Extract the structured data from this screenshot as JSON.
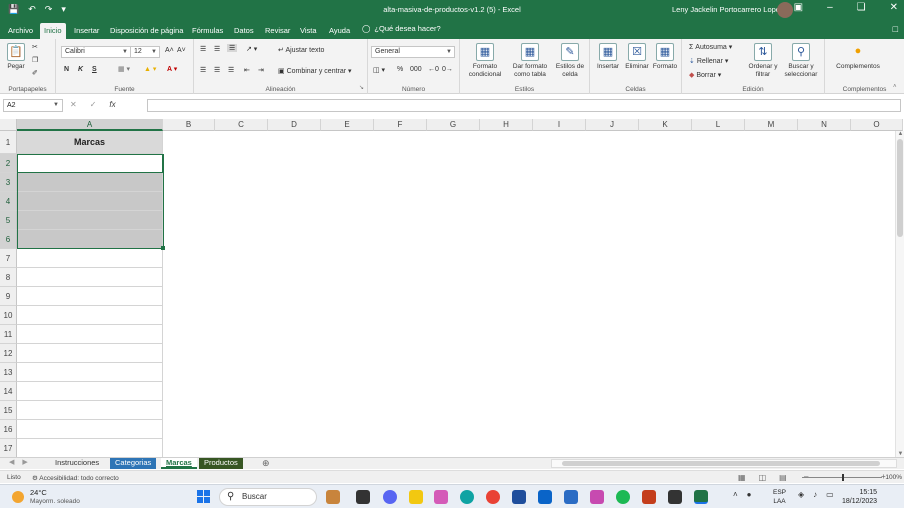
{
  "titlebar": {
    "doc_title": "alta-masiva-de-productos-v1.2 (5)  -  Excel",
    "user": "Leny Jackelin Portocarrero Lopez",
    "qat": [
      "save-icon",
      "undo-icon",
      "redo-icon",
      "customize-icon"
    ],
    "winctl": [
      "ribbon-display-icon",
      "minimize-icon",
      "restore-icon",
      "close-icon"
    ]
  },
  "tabs": [
    "Archivo",
    "Inicio",
    "Insertar",
    "Disposición de página",
    "Fórmulas",
    "Datos",
    "Revisar",
    "Vista",
    "Ayuda"
  ],
  "active_tab": "Inicio",
  "tellme": "¿Qué desea hacer?",
  "ribbon": {
    "clipboard": {
      "paste": "Pegar",
      "name": "Portapapeles"
    },
    "font": {
      "family": "Calibri",
      "size": "12",
      "bold": "N",
      "italic": "K",
      "underline": "S",
      "name": "Fuente"
    },
    "alignment": {
      "wrap": "Ajustar texto",
      "merge": "Combinar y centrar",
      "name": "Alineación"
    },
    "number": {
      "format": "General",
      "percent": "%",
      "thousands": "000",
      "name": "Número"
    },
    "styles": {
      "cond_line1": "Formato",
      "cond_line2": "condicional",
      "table_line1": "Dar formato",
      "table_line2": "como tabla",
      "cell_line1": "Estilos de",
      "cell_line2": "celda",
      "name": "Estilos"
    },
    "cells": {
      "insert": "Insertar",
      "delete": "Eliminar",
      "format": "Formato",
      "name": "Celdas"
    },
    "editing": {
      "autosum": "Autosuma",
      "fill": "Rellenar",
      "clear": "Borrar",
      "sort_line1": "Ordenar y",
      "sort_line2": "filtrar",
      "find_line1": "Buscar y",
      "find_line2": "seleccionar",
      "name": "Edición"
    },
    "addins": {
      "label": "Complementos",
      "name": "Complementos"
    }
  },
  "formula_bar": {
    "name_box": "A2",
    "fx": "fx",
    "value": ""
  },
  "columns": [
    "A",
    "B",
    "C",
    "D",
    "E",
    "F",
    "G",
    "H",
    "I",
    "J",
    "K",
    "L",
    "M",
    "N",
    "O"
  ],
  "rows": [
    "1",
    "2",
    "3",
    "4",
    "5",
    "6",
    "7",
    "8",
    "9",
    "10",
    "11",
    "12",
    "13",
    "14",
    "15",
    "16",
    "17"
  ],
  "cells": {
    "A1": "Marcas"
  },
  "sheets": [
    "Instrucciones",
    "Categorias",
    "Marcas",
    "Productos"
  ],
  "active_sheet": "Marcas",
  "status": {
    "ready": "Listo",
    "accessibility": "Accesibilidad: todo correcto",
    "zoom": "100%"
  },
  "taskbar": {
    "temp": "24°C",
    "weather": "Mayorm. soleado",
    "search": "Buscar",
    "lang1": "ESP",
    "lang2": "LAA",
    "time": "15:15",
    "date": "18/12/2023"
  },
  "colors": {
    "excel_green": "#217346",
    "tab_blue": "#2e75b6",
    "tab_dark_green": "#375623",
    "selection_gray": "#c8c8c8"
  }
}
